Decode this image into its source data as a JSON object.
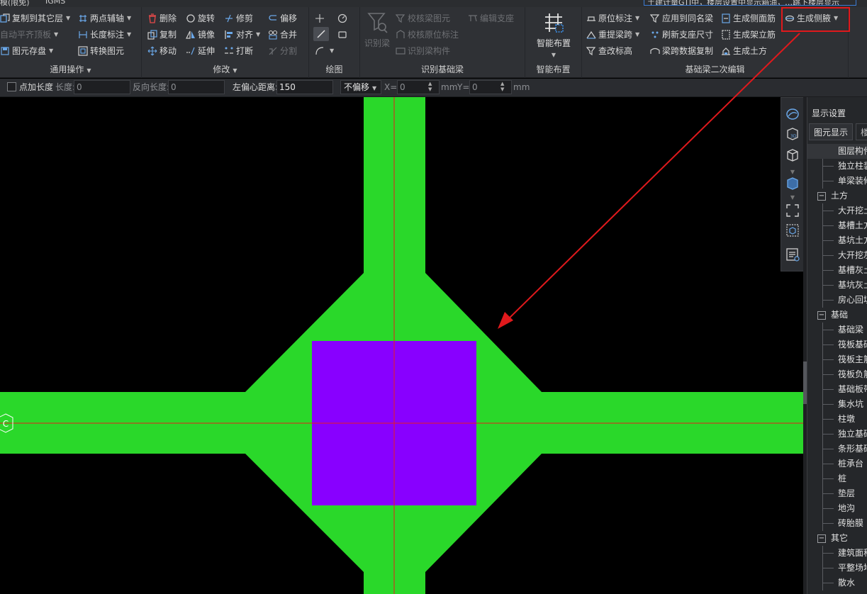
{
  "topbar": {
    "title_fragment": "模(限免)",
    "app_fragment": "IGMS",
    "search_text": "土建计量GTJ中，楼层设置中显示箱油，…跳下楼层显示"
  },
  "ribbon": {
    "general": {
      "title": "通用操作",
      "copy_to_layer": "复制到其它层",
      "two_point_axis": "两点辅轴",
      "auto_align": "自动平齐顶板",
      "length_dim": "长度标注",
      "element_save": "图元存盘",
      "convert_element": "转换图元"
    },
    "modify": {
      "title": "修改",
      "delete": "删除",
      "rotate": "旋转",
      "trim": "修剪",
      "offset": "偏移",
      "copy": "复制",
      "mirror": "镜像",
      "align": "对齐",
      "merge": "合并",
      "move": "移动",
      "extend": "延伸",
      "break": "打断",
      "split": "分割"
    },
    "draw": {
      "title": "绘图"
    },
    "identify": {
      "title": "识别基础梁",
      "identify_beam": "识别梁",
      "check_beam": "校核梁图元",
      "check_annotation": "校核原位标注",
      "identify_component": "识别梁构件",
      "edit_support": "编辑支座"
    },
    "smart": {
      "title": "智能布置",
      "smart_layout": "智能布置"
    },
    "secondary": {
      "title": "基础梁二次编辑",
      "original_annotation": "原位标注",
      "apply_same_name": "应用到同名梁",
      "gen_side_rebar": "生成侧面筋",
      "gen_haunch": "生成侧腋",
      "re_span": "重提梁跨",
      "refresh_support": "刷新支座尺寸",
      "gen_stand_rebar": "生成架立筋",
      "check_elevation": "查改标高",
      "span_data_copy": "梁跨数据复制",
      "gen_earthwork": "生成土方"
    }
  },
  "propbar": {
    "point_length_label": "点加长度",
    "length_label": "长度:",
    "length_value": "0",
    "reverse_length_label": "反向长度:",
    "reverse_length_value": "0",
    "left_offset_label": "左偏心距离:",
    "left_offset_value": "150",
    "offset_mode": "不偏移",
    "x_label": "X=",
    "x_value": "0",
    "x_unit": "mm",
    "y_label": "Y=",
    "y_value": "0",
    "y_unit": "mm"
  },
  "canvas": {
    "axis_label": "C",
    "beam_color": "#2ad82a",
    "column_color": "#8800ff",
    "axis_color": "#e81c1c",
    "arrow_color": "#e0191c"
  },
  "panel": {
    "title": "显示设置",
    "tab_active": "图元显示",
    "tab_inactive": "楼层显示",
    "rows": [
      {
        "type": "item",
        "label": "图层构件"
      },
      {
        "type": "item",
        "label": "独立柱装"
      },
      {
        "type": "item",
        "label": "单梁装修"
      },
      {
        "type": "group",
        "label": "土方"
      },
      {
        "type": "item",
        "label": "大开挖土"
      },
      {
        "type": "item",
        "label": "基槽土方"
      },
      {
        "type": "item",
        "label": "基坑土方"
      },
      {
        "type": "item",
        "label": "大开挖灰"
      },
      {
        "type": "item",
        "label": "基槽灰土"
      },
      {
        "type": "item",
        "label": "基坑灰土"
      },
      {
        "type": "item",
        "label": "房心回填"
      },
      {
        "type": "group",
        "label": "基础"
      },
      {
        "type": "item",
        "label": "基础梁"
      },
      {
        "type": "item",
        "label": "筏板基础"
      },
      {
        "type": "item",
        "label": "筏板主筋"
      },
      {
        "type": "item",
        "label": "筏板负筋"
      },
      {
        "type": "item",
        "label": "基础板带"
      },
      {
        "type": "item",
        "label": "集水坑"
      },
      {
        "type": "item",
        "label": "柱墩"
      },
      {
        "type": "item",
        "label": "独立基础"
      },
      {
        "type": "item",
        "label": "条形基础"
      },
      {
        "type": "item",
        "label": "桩承台"
      },
      {
        "type": "item",
        "label": "桩"
      },
      {
        "type": "item",
        "label": "垫层"
      },
      {
        "type": "item",
        "label": "地沟"
      },
      {
        "type": "item",
        "label": "砖胎膜"
      },
      {
        "type": "group",
        "label": "其它"
      },
      {
        "type": "item",
        "label": "建筑面积"
      },
      {
        "type": "item",
        "label": "平整场地"
      },
      {
        "type": "item",
        "label": "散水"
      }
    ]
  }
}
